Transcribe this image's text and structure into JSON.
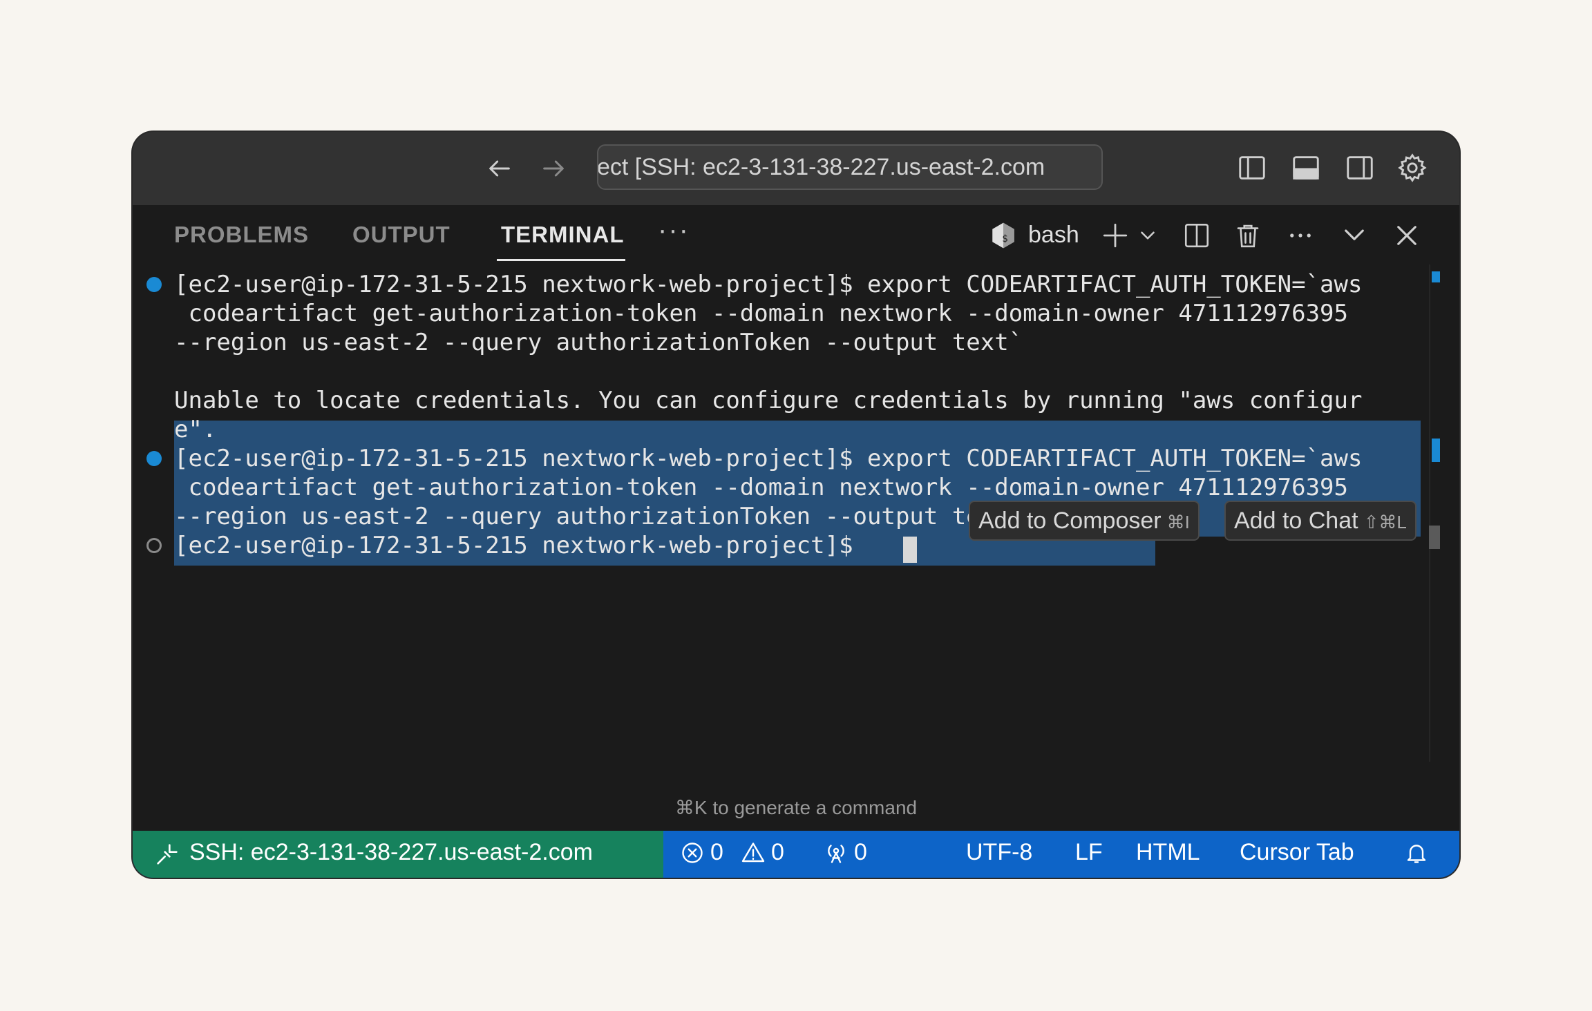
{
  "titlebar": {
    "search_text": "ect [SSH: ec2-3-131-38-227.us-east-2.com"
  },
  "panel": {
    "tabs": [
      {
        "label": "PROBLEMS"
      },
      {
        "label": "OUTPUT"
      },
      {
        "label": "TERMINAL"
      }
    ],
    "more_label": "···",
    "shell_label": "bash"
  },
  "terminal": {
    "lines": [
      "[ec2-user@ip-172-31-5-215 nextwork-web-project]$ export CODEARTIFACT_AUTH_TOKEN=`aws",
      " codeartifact get-authorization-token --domain nextwork --domain-owner 471112976395",
      "--region us-east-2 --query authorizationToken --output text`",
      "",
      "Unable to locate credentials. You can configure credentials by running \"aws configur",
      "e\".",
      "[ec2-user@ip-172-31-5-215 nextwork-web-project]$ export CODEARTIFACT_AUTH_TOKEN=`aws",
      " codeartifact get-authorization-token --domain nextwork --domain-owner 471112976395",
      "--region us-east-2 --query authorizationToken --output text`",
      "[ec2-user@ip-172-31-5-215 nextwork-web-project]$ "
    ],
    "popup": {
      "composer_label": "Add to Composer",
      "composer_shortcut": "⌘I",
      "chat_label": "Add to Chat",
      "chat_shortcut": "⇧⌘L"
    },
    "hint": "⌘K to generate a command"
  },
  "statusbar": {
    "remote": "SSH: ec2-3-131-38-227.us-east-2.com",
    "errors": "0",
    "warnings": "0",
    "ports": "0",
    "encoding": "UTF-8",
    "eol": "LF",
    "language": "HTML",
    "cursor_tab": "Cursor Tab"
  },
  "colors": {
    "status_blue": "#0d64c8",
    "remote_green": "#16825d",
    "selection": "#264f78",
    "decoration_blue": "#1a8ad4"
  }
}
